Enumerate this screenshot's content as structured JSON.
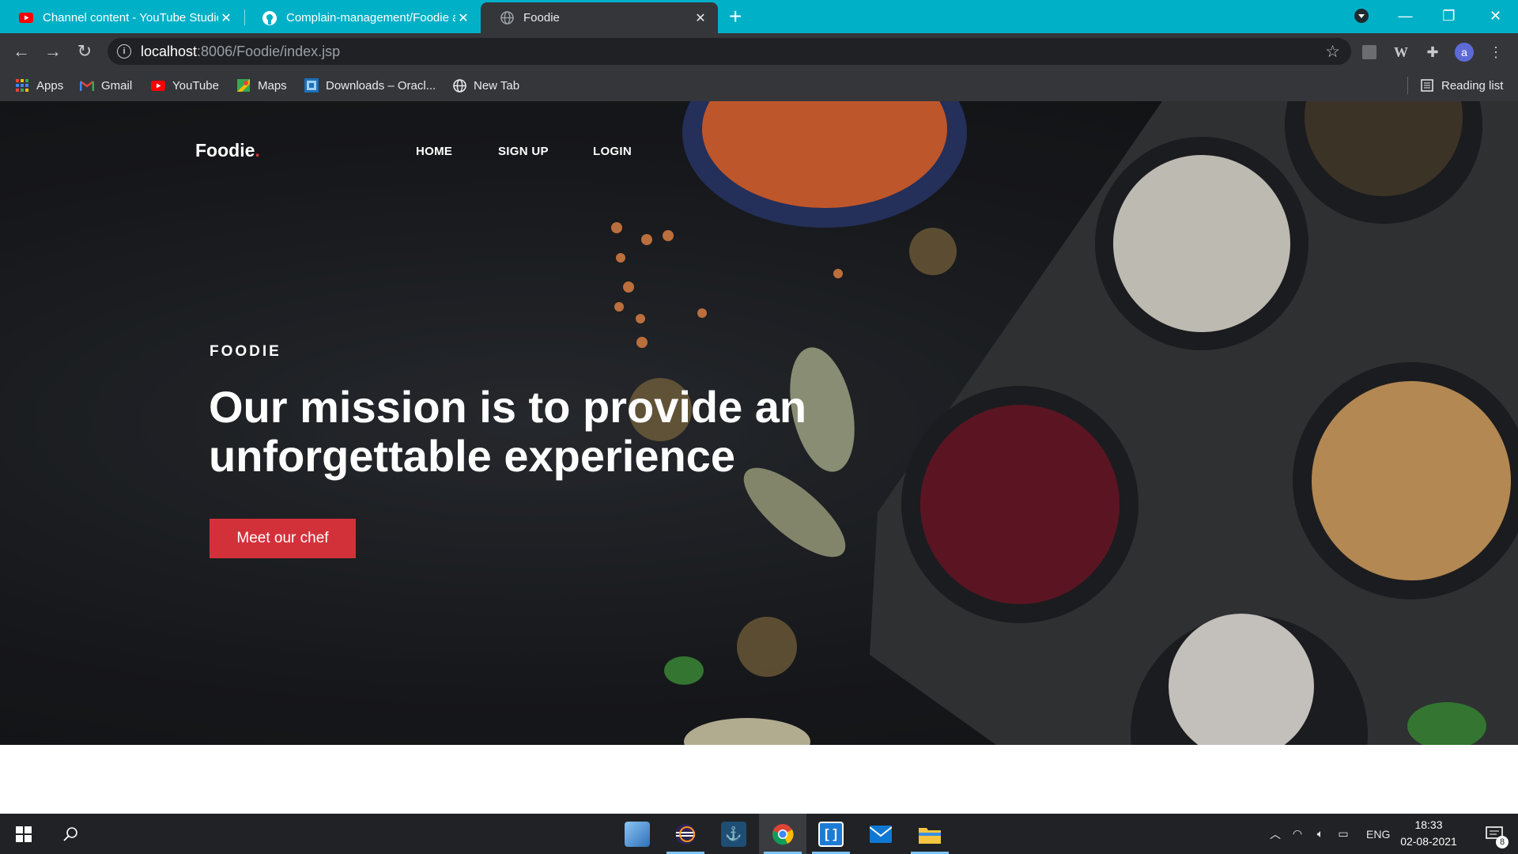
{
  "browser": {
    "tabs": [
      {
        "title": "Channel content - YouTube Studio",
        "favicon": "youtube-icon"
      },
      {
        "title": "Complain-management/Foodie at main",
        "favicon": "github-icon"
      },
      {
        "title": "Foodie",
        "favicon": "globe-icon"
      }
    ],
    "url_host": "localhost",
    "url_path": ":8006/Foodie/index.jsp",
    "bookmarks": [
      "Apps",
      "Gmail",
      "YouTube",
      "Maps",
      "Downloads – Oracl...",
      "New Tab"
    ],
    "reading_list": "Reading list",
    "profile_initial": "a"
  },
  "site": {
    "brand": "Foodie",
    "brand_dot": ".",
    "nav": [
      "HOME",
      "SIGN UP",
      "LOGIN"
    ],
    "kicker": "FOODIE",
    "headline": "Our mission is to provide an unforgettable experience",
    "cta": "Meet our chef"
  },
  "taskbar": {
    "language": "ENG",
    "time": "18:33",
    "date": "02-08-2021",
    "notification_count": "8"
  },
  "colors": {
    "tabstrip": "#00b0c7",
    "accent": "#d3313a",
    "hero_bg": "#1c1e22"
  }
}
